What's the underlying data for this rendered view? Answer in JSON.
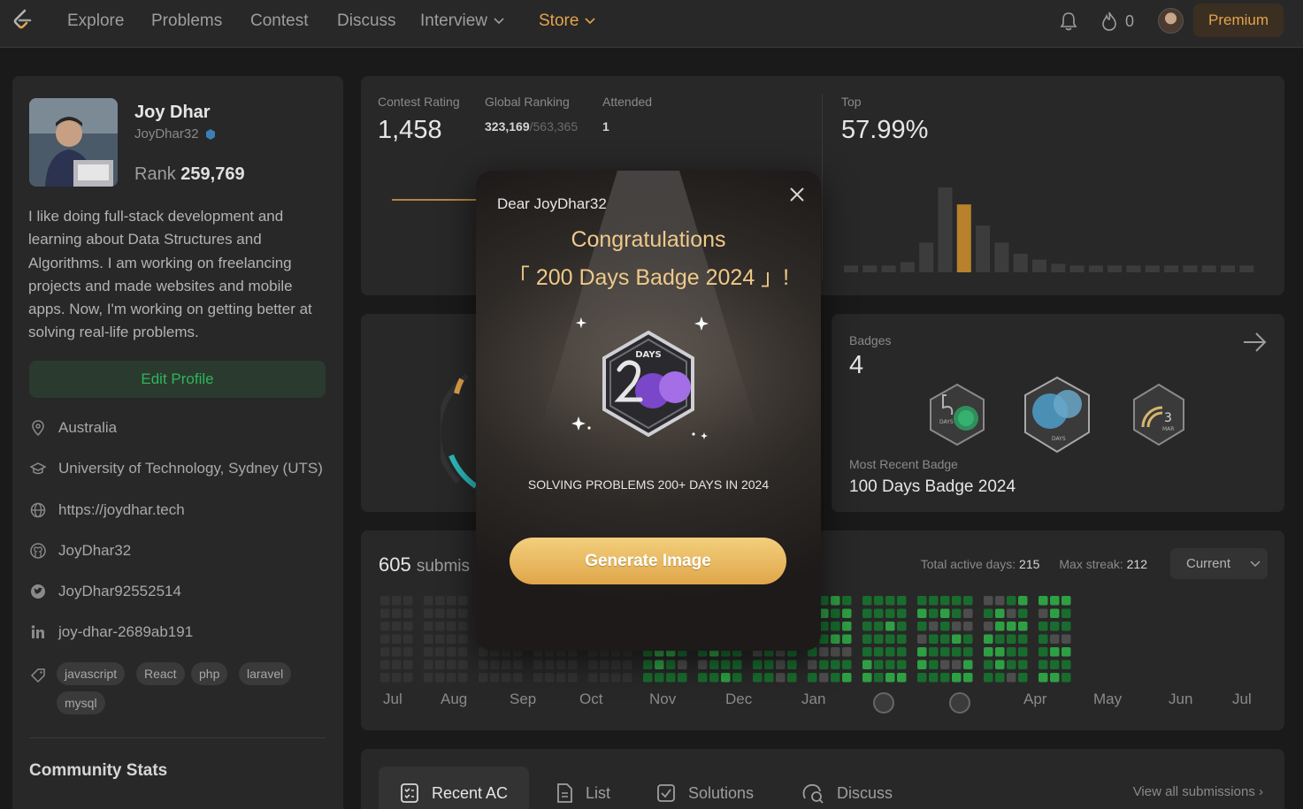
{
  "nav": {
    "items": [
      "Explore",
      "Problems",
      "Contest",
      "Discuss",
      "Interview",
      "Store"
    ],
    "streak_count": "0",
    "premium_label": "Premium"
  },
  "profile": {
    "name": "Joy Dhar",
    "username": "JoyDhar32",
    "rank_label": "Rank",
    "rank_value": "259,769",
    "bio": "I like doing full-stack development and learning about Data Structures and Algorithms. I am working on freelancing projects and made websites and mobile apps. Now, I'm working on getting better at solving real-life problems.",
    "edit_label": "Edit Profile",
    "location": "Australia",
    "school": "University of Technology, Sydney (UTS)",
    "website": "https://joydhar.tech",
    "github": "JoyDhar32",
    "twitter": "JoyDhar92552514",
    "linkedin": "joy-dhar-2689ab191",
    "skills": [
      "javascript",
      "React",
      "php",
      "laravel",
      "mysql"
    ],
    "community_title": "Community Stats"
  },
  "contest": {
    "rating_label": "Contest Rating",
    "rating_value": "1,458",
    "global_label": "Global Ranking",
    "global_value": "323,169",
    "global_total": "/563,365",
    "attended_label": "Attended",
    "attended_value": "1",
    "top_label": "Top",
    "top_value": "57.99%",
    "histogram_levels": [
      0.08,
      0.08,
      0.08,
      0.12,
      0.35,
      1.0,
      0.8,
      0.55,
      0.35,
      0.22,
      0.15,
      0.1,
      0.08,
      0.08,
      0.08,
      0.08,
      0.08,
      0.08,
      0.08,
      0.08,
      0.08,
      0.08
    ],
    "highlight_index": 6
  },
  "badges": {
    "label": "Badges",
    "count": "4",
    "recent_label": "Most Recent Badge",
    "recent_name": "100 Days Badge 2024"
  },
  "calendar": {
    "submissions_count": "605",
    "submissions_word": "submis",
    "active_label": "Total active days:",
    "active_value": "215",
    "streak_label": "Max streak:",
    "streak_value": "212",
    "selector": "Current",
    "months": [
      "Jul",
      "Aug",
      "Sep",
      "Oct",
      "Nov",
      "Dec",
      "Jan",
      "",
      "",
      "Apr",
      "May",
      "Jun",
      "Jul"
    ]
  },
  "tabs": {
    "items": [
      "Recent AC",
      "List",
      "Solutions",
      "Discuss"
    ],
    "view_all": "View all submissions"
  },
  "modal": {
    "greeting": "Dear JoyDhar32",
    "congrats": "Congratulations",
    "badge_title": "「 200 Days Badge 2024 」!",
    "badge_art_text": "DAYS",
    "description": "SOLVING PROBLEMS 200+ DAYS IN 2024",
    "button": "Generate Image"
  },
  "colors": {
    "accent_orange": "#e3a34a",
    "green": "#2db55d",
    "gold_button": "#e9b95f"
  }
}
